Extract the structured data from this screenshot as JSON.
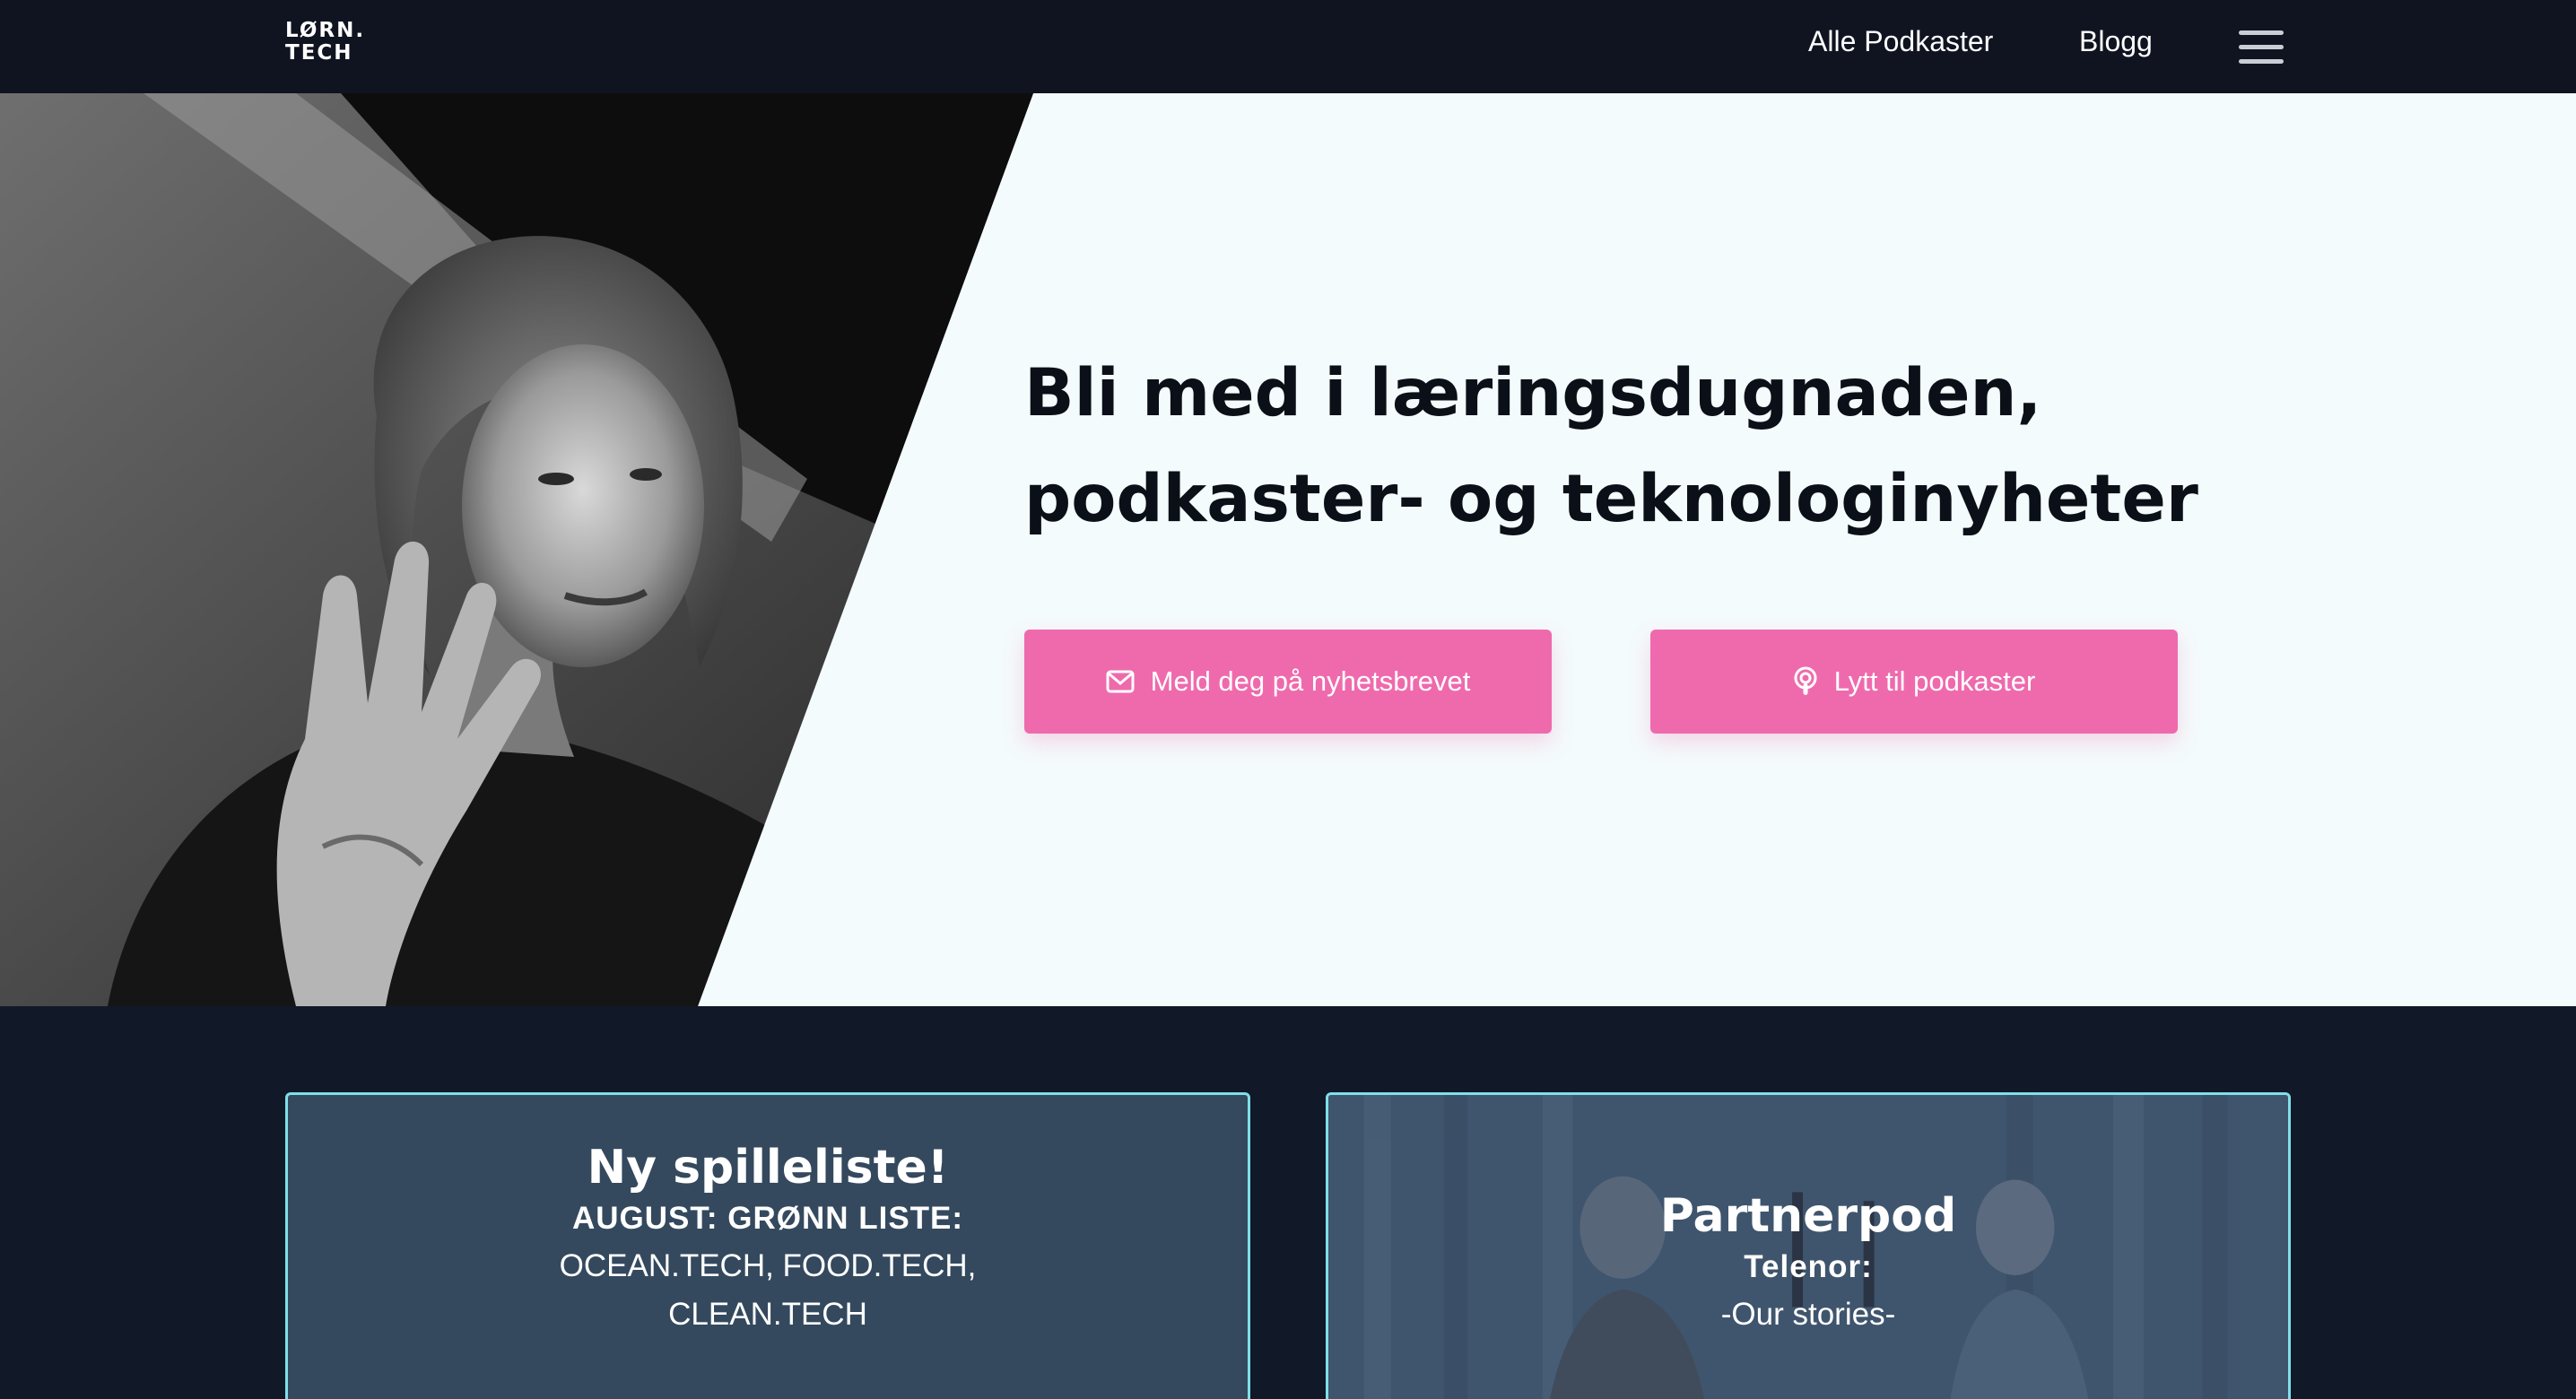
{
  "nav": {
    "logo_line1": "LØRN.",
    "logo_line2": "TECH",
    "links": [
      {
        "label": "Alle Podkaster"
      },
      {
        "label": "Blogg"
      }
    ],
    "menu_icon": "hamburger-menu-icon"
  },
  "hero": {
    "title_line1": "Bli med i læringsdugnaden,",
    "title_line2": "podkaster- og teknologinyheter",
    "photo": "black-and-white photo of a speaker gesturing",
    "buttons": [
      {
        "label": "Meld deg på nyhetsbrevet",
        "icon": "envelope-icon"
      },
      {
        "label": "Lytt til podkaster",
        "icon": "podcast-icon"
      }
    ]
  },
  "cards": [
    {
      "title": "Ny spilleliste!",
      "subtitle": "AUGUST: GRØNN LISTE:",
      "text_line1": "OCEAN.TECH, FOOD.TECH,",
      "text_line2": "CLEAN.TECH"
    },
    {
      "title": "Partnerpod",
      "subtitle": "Telenor:",
      "text": "-Our stories-"
    }
  ],
  "colors": {
    "nav_bg": "#0f1420",
    "page_bg": "#111827",
    "hero_bg": "#f4fbfc",
    "accent_pink": "#ef6aad",
    "card_border": "#7ee0ea",
    "card_bg": "#34495e"
  }
}
